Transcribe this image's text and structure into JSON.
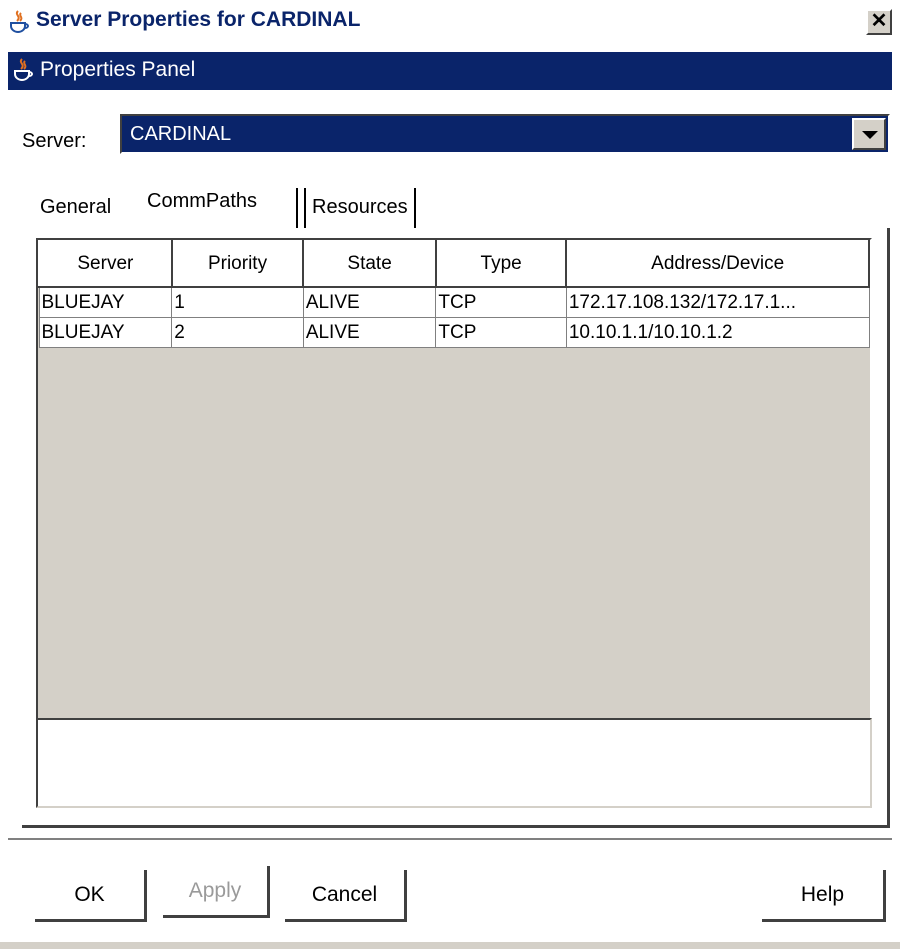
{
  "window": {
    "title": "Server Properties for CARDINAL",
    "close_label": "✕"
  },
  "panel": {
    "title": "Properties Panel"
  },
  "server_selector": {
    "label": "Server:",
    "value": "CARDINAL"
  },
  "tabs": [
    {
      "label": "General"
    },
    {
      "label": "CommPaths"
    },
    {
      "label": "Resources"
    }
  ],
  "table": {
    "columns": [
      "Server",
      "Priority",
      "State",
      "Type",
      "Address/Device"
    ],
    "rows": [
      [
        "BLUEJAY",
        "1",
        "ALIVE",
        "TCP",
        "172.17.108.132/172.17.1..."
      ],
      [
        "BLUEJAY",
        "2",
        "ALIVE",
        "TCP",
        "10.10.1.1/10.10.1.2"
      ]
    ]
  },
  "buttons": {
    "ok": "OK",
    "apply": "Apply",
    "cancel": "Cancel",
    "help": "Help"
  },
  "colors": {
    "title_blue": "#0a246a",
    "panel_gray": "#d4d0c8"
  },
  "icons": {
    "app": "java-coffee-icon"
  }
}
